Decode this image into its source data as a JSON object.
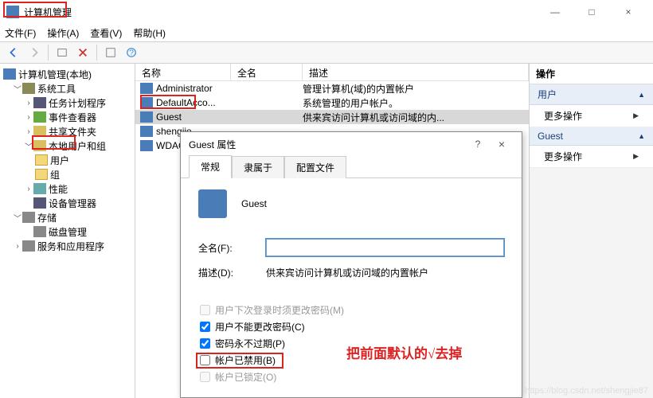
{
  "window": {
    "title": "计算机管理"
  },
  "winbtns": {
    "min": "—",
    "max": "□",
    "close": "×"
  },
  "menu": {
    "file": "文件(F)",
    "action": "操作(A)",
    "view": "查看(V)",
    "help": "帮助(H)"
  },
  "tree": {
    "root": "计算机管理(本地)",
    "systools": "系统工具",
    "sched": "任务计划程序",
    "event": "事件查看器",
    "share": "共享文件夹",
    "localusers": "本地用户和组",
    "users": "用户",
    "groups": "组",
    "perf": "性能",
    "devmgr": "设备管理器",
    "storage": "存储",
    "disk": "磁盘管理",
    "services": "服务和应用程序"
  },
  "listhdr": {
    "name": "名称",
    "fullname": "全名",
    "desc": "描述"
  },
  "users": [
    {
      "name": "Administrator",
      "desc": "管理计算机(域)的内置帐户"
    },
    {
      "name": "DefaultAcco...",
      "desc": "系统管理的用户帐户。"
    },
    {
      "name": "Guest",
      "desc": "供来宾访问计算机或访问域的内..."
    },
    {
      "name": "shengjie",
      "desc": ""
    },
    {
      "name": "WDAGU...",
      "desc": ""
    }
  ],
  "actions": {
    "title": "操作",
    "user": "用户",
    "more": "更多操作",
    "guest": "Guest"
  },
  "dialog": {
    "title": "Guest 属性",
    "tabs": {
      "general": "常规",
      "memberof": "隶属于",
      "profile": "配置文件"
    },
    "name": "Guest",
    "fullname_lbl": "全名(F):",
    "fullname_val": "",
    "desc_lbl": "描述(D):",
    "desc_val": "供来宾访问计算机或访问域的内置帐户",
    "chk_mustchange": "用户下次登录时须更改密码(M)",
    "chk_cantchange": "用户不能更改密码(C)",
    "chk_neverexp": "密码永不过期(P)",
    "chk_disabled": "帐户已禁用(B)",
    "chk_locked": "帐户已锁定(O)"
  },
  "annotation": "把前面默认的√去掉",
  "watermark": "https://blog.csdn.net/shengjie87"
}
